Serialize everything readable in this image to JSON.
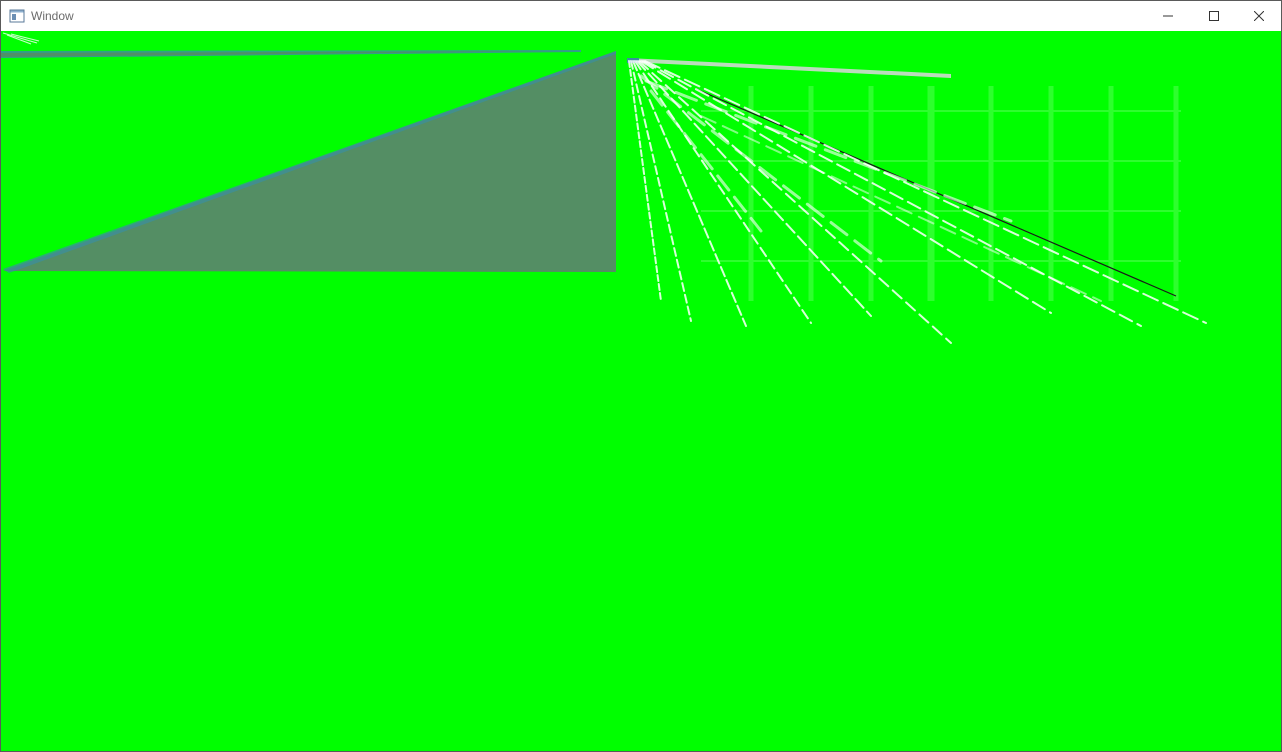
{
  "window": {
    "title": "Window"
  },
  "titlebar": {
    "app_icon": "window-app-icon",
    "minimize_icon": "minimize-icon",
    "maximize_icon": "maximize-icon",
    "close_icon": "close-icon"
  },
  "viewport": {
    "background_color": "#00ff00",
    "triangle_color": "#548e64",
    "triangle_edge_color": "#3a8fa0",
    "streak_color": "#ffffff",
    "dark_line_color": "#1a1a1a"
  }
}
